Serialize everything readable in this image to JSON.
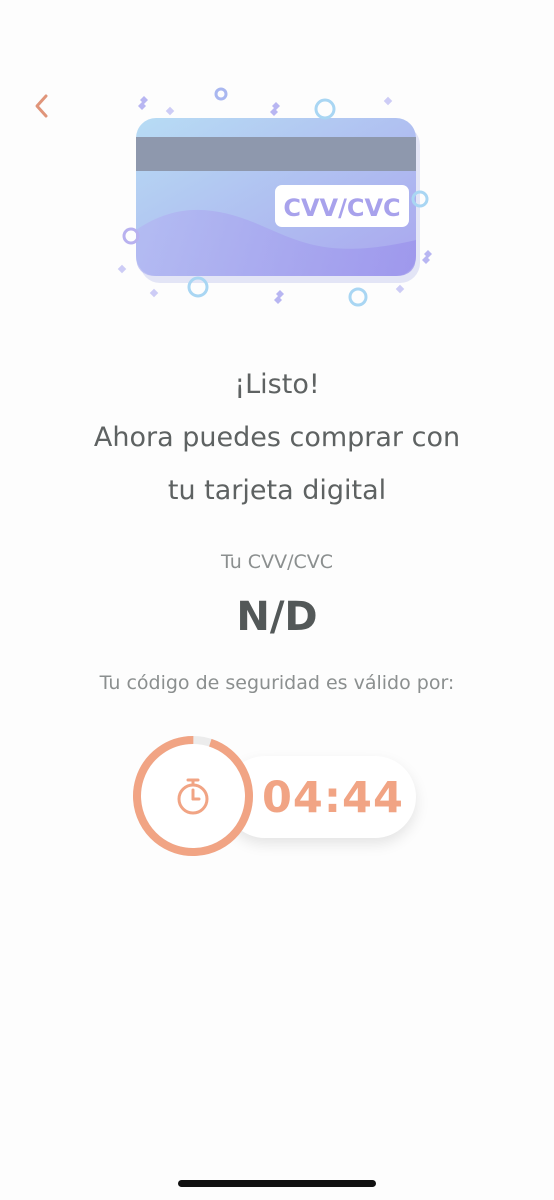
{
  "header": {
    "back_icon": "chevron-left-icon"
  },
  "illustration": {
    "card_badge": "CVV/CVC"
  },
  "message": {
    "line1": "¡Listo!",
    "line2": "Ahora puedes comprar con",
    "line3": "tu tarjeta digital"
  },
  "cvv": {
    "label": "Tu CVV/CVC",
    "value": "N/D"
  },
  "validity": {
    "text": "Tu código de seguridad es válido por:"
  },
  "timer": {
    "value": "04:44",
    "icon": "stopwatch-icon",
    "remaining_fraction": 0.95
  },
  "colors": {
    "accent": "#f1a484",
    "back_arrow": "#e0957a",
    "text": "#5e6262",
    "muted": "#8b8f8f"
  }
}
